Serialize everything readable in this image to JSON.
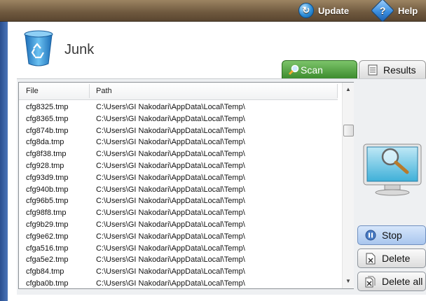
{
  "toolbar": {
    "update_label": "Update",
    "help_label": "Help",
    "help_glyph": "?"
  },
  "page": {
    "title": "Junk"
  },
  "tabs": [
    {
      "label": "Scan",
      "icon": "magnifier-icon",
      "active": true,
      "color": "#4e9a3c"
    },
    {
      "label": "Results",
      "icon": "document-icon",
      "active": false
    }
  ],
  "list": {
    "columns": [
      "File",
      "Path"
    ],
    "rows": [
      {
        "file": "cfg8325.tmp",
        "path": "C:\\Users\\GI Nakodari\\AppData\\Local\\Temp\\"
      },
      {
        "file": "cfg8365.tmp",
        "path": "C:\\Users\\GI Nakodari\\AppData\\Local\\Temp\\"
      },
      {
        "file": "cfg874b.tmp",
        "path": "C:\\Users\\GI Nakodari\\AppData\\Local\\Temp\\"
      },
      {
        "file": "cfg8da.tmp",
        "path": "C:\\Users\\GI Nakodari\\AppData\\Local\\Temp\\"
      },
      {
        "file": "cfg8f38.tmp",
        "path": "C:\\Users\\GI Nakodari\\AppData\\Local\\Temp\\"
      },
      {
        "file": "cfg928.tmp",
        "path": "C:\\Users\\GI Nakodari\\AppData\\Local\\Temp\\"
      },
      {
        "file": "cfg93d9.tmp",
        "path": "C:\\Users\\GI Nakodari\\AppData\\Local\\Temp\\"
      },
      {
        "file": "cfg940b.tmp",
        "path": "C:\\Users\\GI Nakodari\\AppData\\Local\\Temp\\"
      },
      {
        "file": "cfg96b5.tmp",
        "path": "C:\\Users\\GI Nakodari\\AppData\\Local\\Temp\\"
      },
      {
        "file": "cfg98f8.tmp",
        "path": "C:\\Users\\GI Nakodari\\AppData\\Local\\Temp\\"
      },
      {
        "file": "cfg9b29.tmp",
        "path": "C:\\Users\\GI Nakodari\\AppData\\Local\\Temp\\"
      },
      {
        "file": "cfg9e62.tmp",
        "path": "C:\\Users\\GI Nakodari\\AppData\\Local\\Temp\\"
      },
      {
        "file": "cfga516.tmp",
        "path": "C:\\Users\\GI Nakodari\\AppData\\Local\\Temp\\"
      },
      {
        "file": "cfga5e2.tmp",
        "path": "C:\\Users\\GI Nakodari\\AppData\\Local\\Temp\\"
      },
      {
        "file": "cfgb84.tmp",
        "path": "C:\\Users\\GI Nakodari\\AppData\\Local\\Temp\\"
      },
      {
        "file": "cfgba0b.tmp",
        "path": "C:\\Users\\GI Nakodari\\AppData\\Local\\Temp\\"
      }
    ]
  },
  "actions": {
    "stop_label": "Stop",
    "delete_label": "Delete",
    "delete_all_label": "Delete all"
  },
  "colors": {
    "topbar": "#6e583e",
    "accent_blue": "#2d8ed8",
    "scan_tab": "#4e9a3c"
  }
}
